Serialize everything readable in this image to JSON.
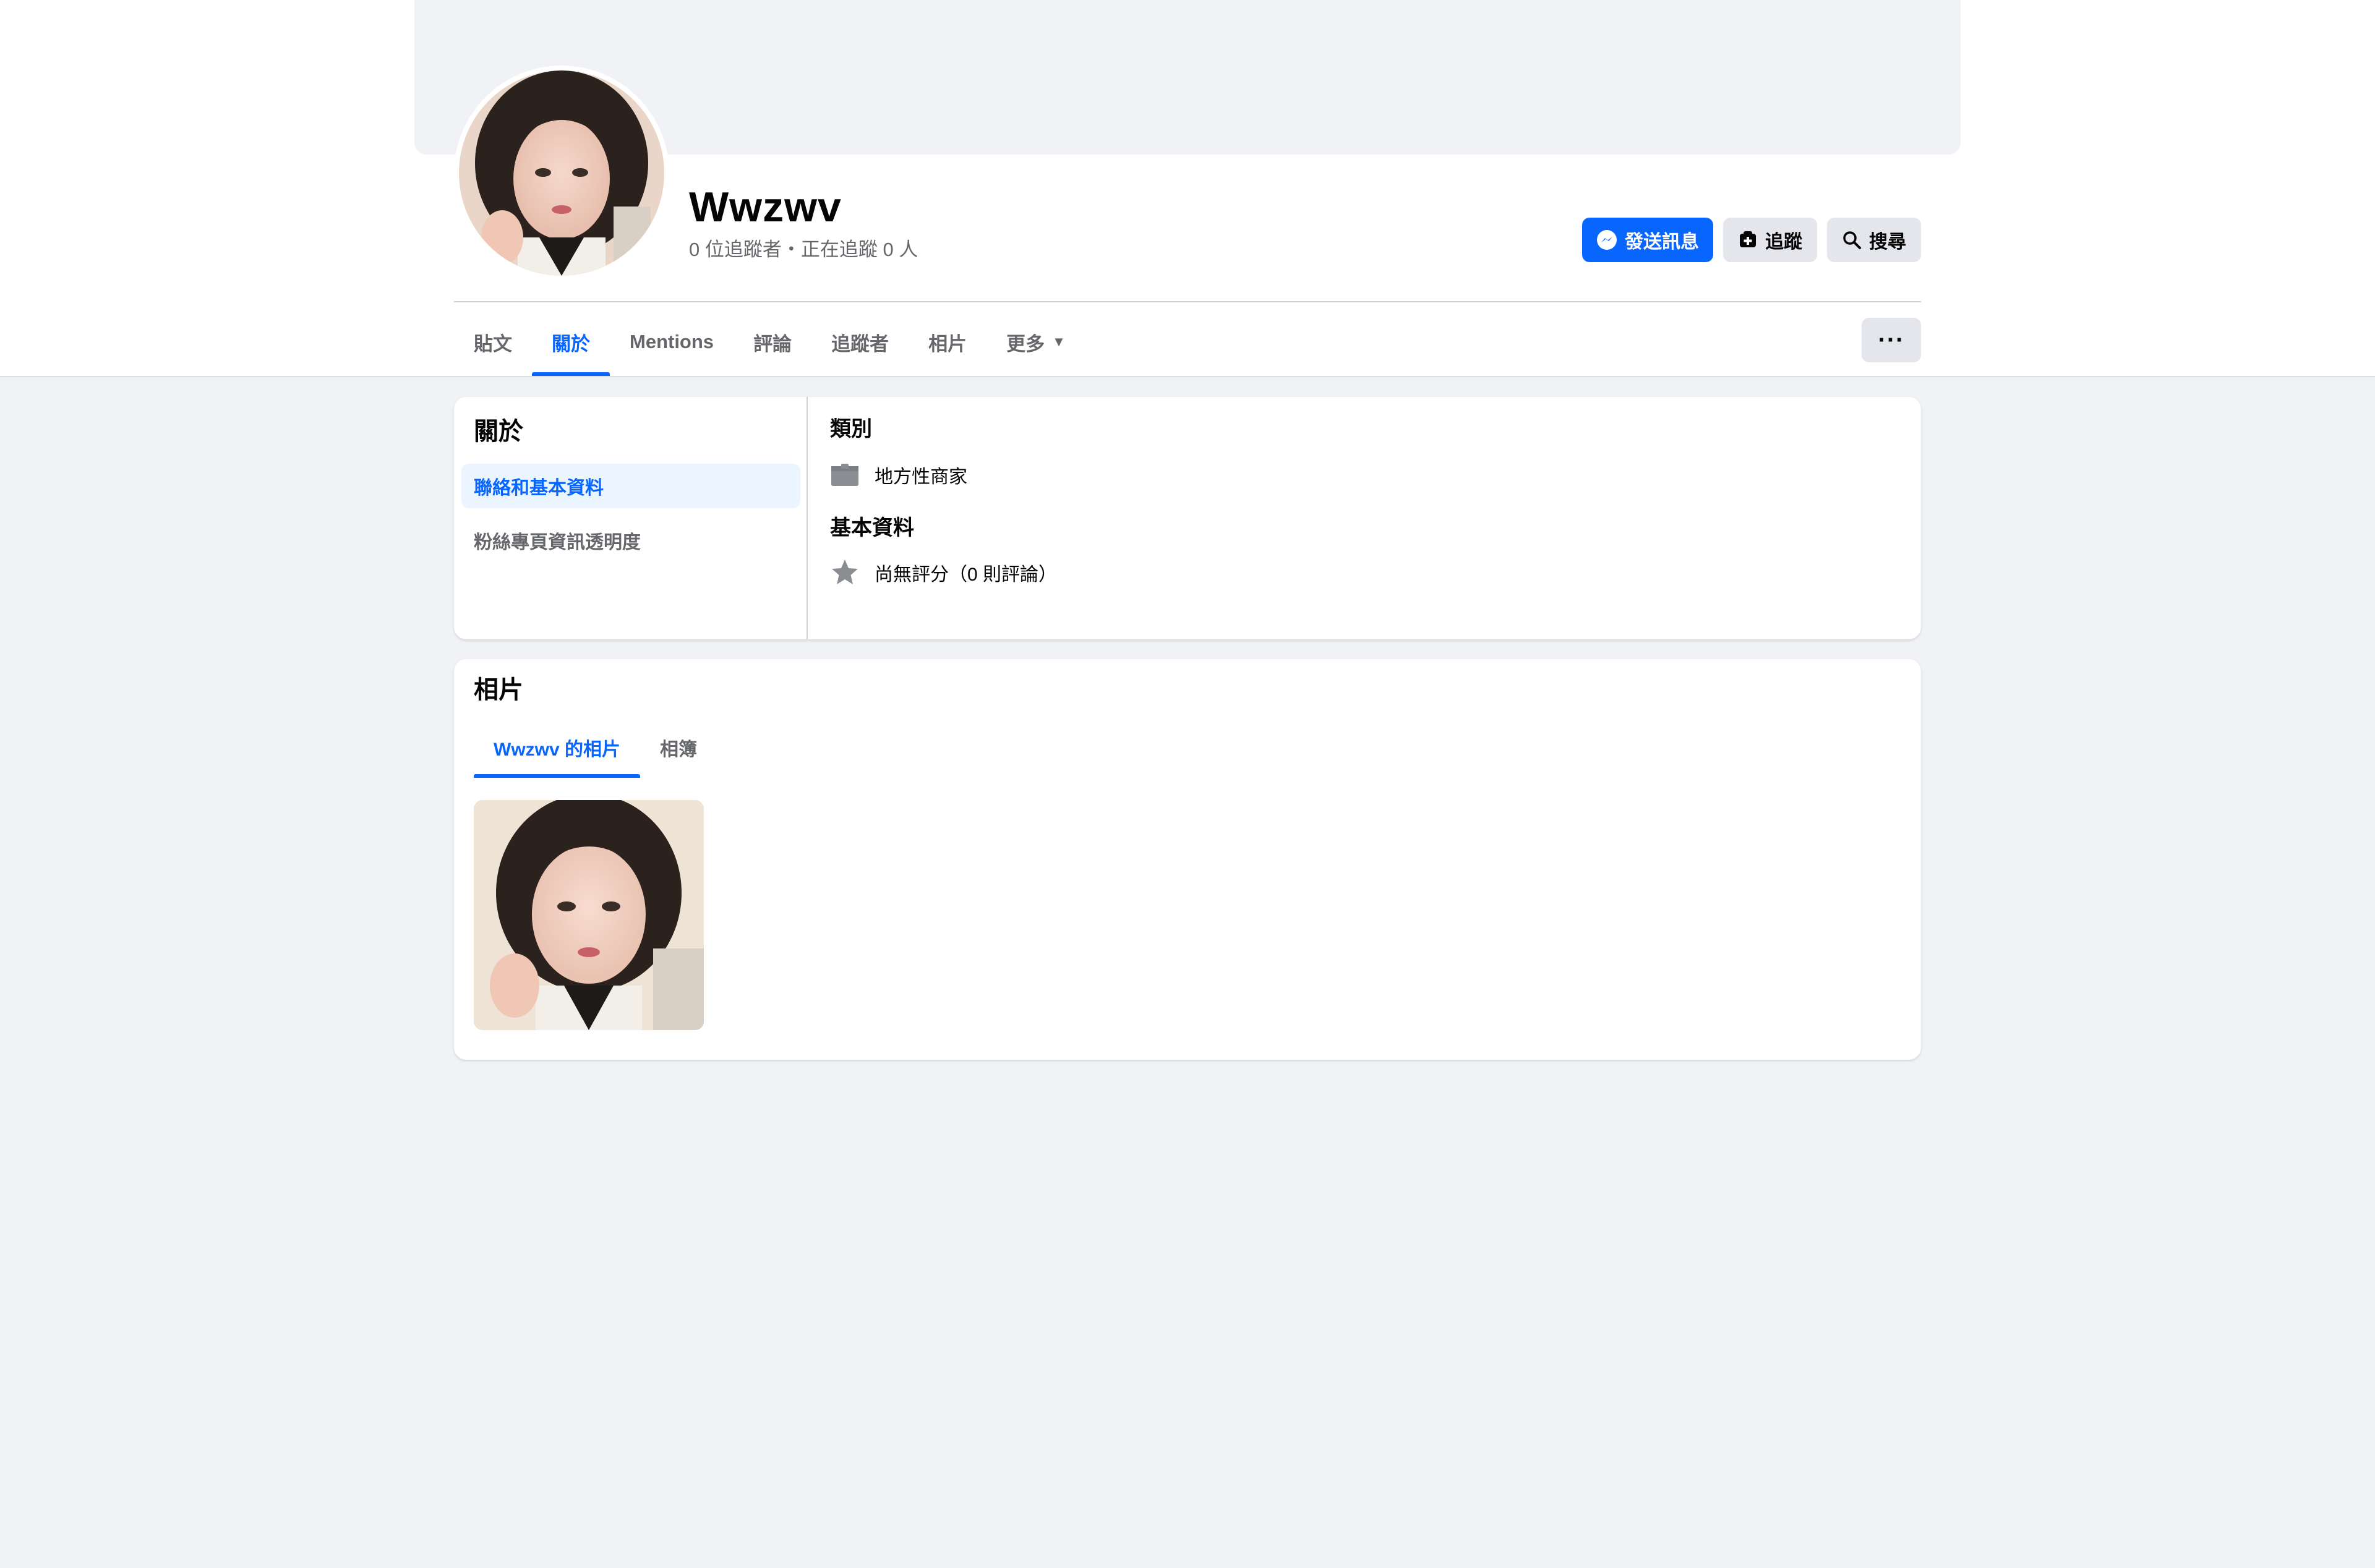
{
  "page": {
    "name": "Wwzwv",
    "stats": "0 位追蹤者・正在追蹤 0 人"
  },
  "actions": {
    "message": "發送訊息",
    "follow": "追蹤",
    "search": "搜尋",
    "more": "···"
  },
  "tabs": [
    {
      "label": "貼文",
      "active": false
    },
    {
      "label": "關於",
      "active": true
    },
    {
      "label": "Mentions",
      "active": false
    },
    {
      "label": "評論",
      "active": false
    },
    {
      "label": "追蹤者",
      "active": false
    },
    {
      "label": "相片",
      "active": false
    },
    {
      "label": "更多",
      "active": false
    }
  ],
  "about": {
    "title": "關於",
    "nav": [
      {
        "label": "聯絡和基本資料",
        "active": true
      },
      {
        "label": "粉絲專頁資訊透明度",
        "active": false
      }
    ],
    "category_heading": "類別",
    "category_value": "地方性商家",
    "basic_heading": "基本資料",
    "rating_value": "尚無評分（0 則評論）"
  },
  "photos": {
    "title": "相片",
    "tabs": [
      {
        "label": "Wwzwv 的相片",
        "active": true
      },
      {
        "label": "相簿",
        "active": false
      }
    ]
  },
  "colors": {
    "accent": "#0866ff",
    "background": "#f0f2f5",
    "secondary_text": "#65676b"
  },
  "icons": {
    "message": "messenger-icon",
    "follow": "follow-icon",
    "search": "search-icon",
    "category": "briefcase-icon",
    "rating": "star-icon",
    "dropdown": "caret-down-icon"
  }
}
